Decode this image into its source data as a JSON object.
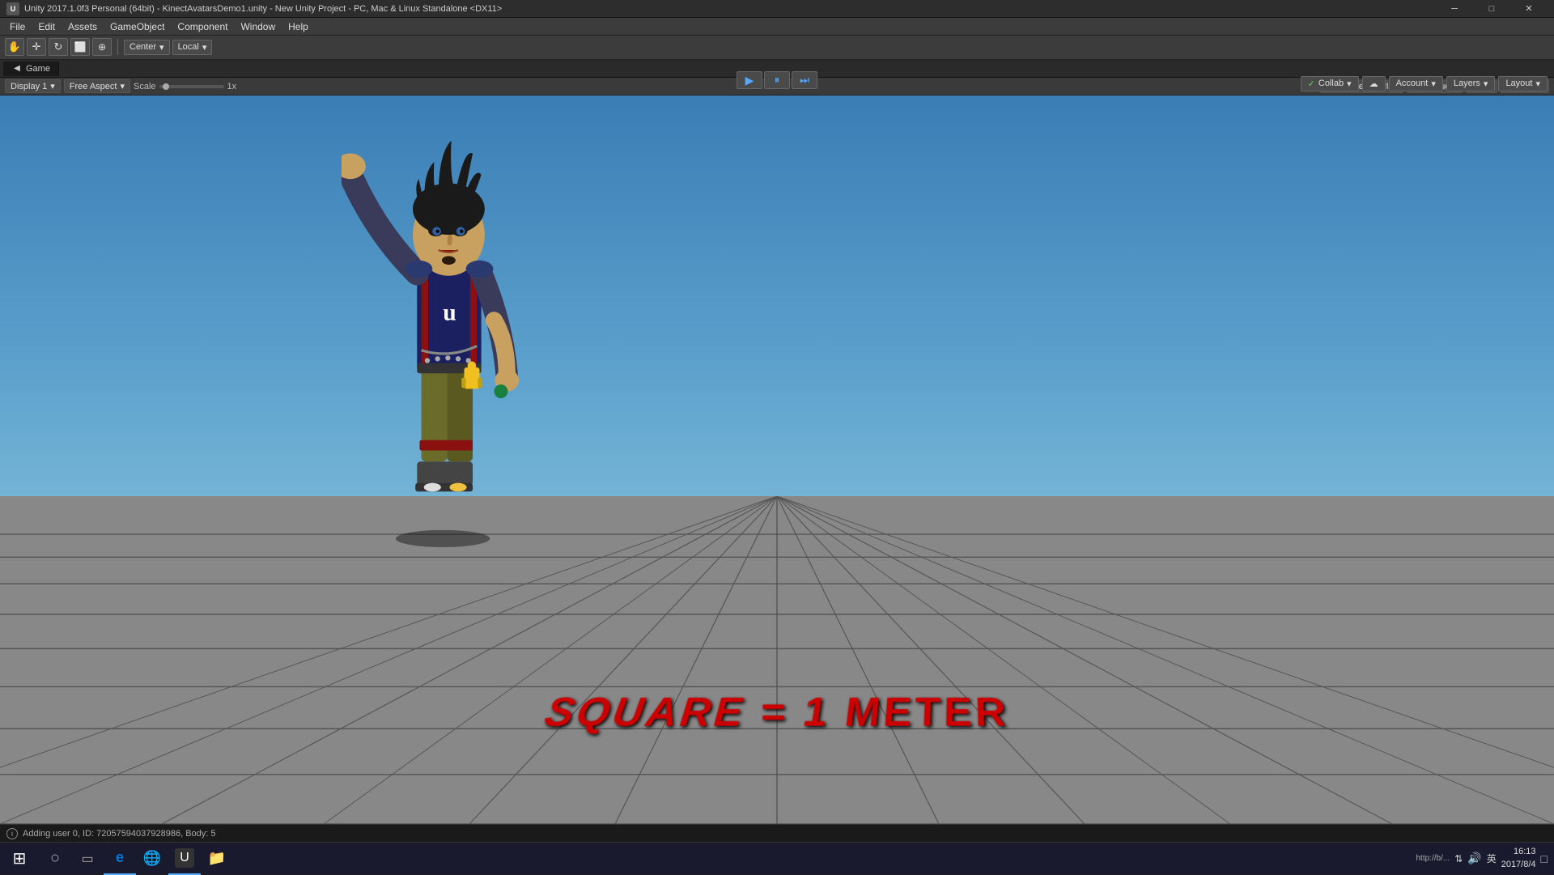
{
  "titlebar": {
    "icon_label": "U",
    "title": "Unity 2017.1.0f3 Personal (64bit) - KinectAvatarsDemo1.unity - New Unity Project - PC, Mac & Linux Standalone <DX11>",
    "min_btn": "─",
    "max_btn": "□",
    "close_btn": "✕"
  },
  "menubar": {
    "items": [
      "File",
      "Edit",
      "Assets",
      "GameObject",
      "Component",
      "Window",
      "Help"
    ]
  },
  "toolbar": {
    "tools": [
      "↺",
      "✛",
      "⟳",
      "⬜",
      "⊕"
    ],
    "transform_center": "Center",
    "transform_local": "Local"
  },
  "play_controls": {
    "play_btn": "▶",
    "pause_btn": "⏸",
    "step_btn": "⏭"
  },
  "right_toolbar": {
    "collab_label": "Collab",
    "cloud_icon": "☁",
    "account_label": "Account",
    "layers_label": "Layers",
    "layout_label": "Layout"
  },
  "game_panel": {
    "tab_icon": "◀",
    "tab_label": "Game"
  },
  "game_view_toolbar": {
    "display_label": "Display 1",
    "aspect_label": "Free Aspect",
    "scale_label": "Scale",
    "scale_value": "1x",
    "right_buttons": [
      "Maximize On Play",
      "Mute Audio",
      "Stats",
      "Gizmos"
    ]
  },
  "scene": {
    "floor_text": "SQUARE = 1 METER"
  },
  "status_bar": {
    "message": "Adding user 0, ID: 72057594037928986, Body: 5"
  },
  "taskbar": {
    "start_icon": "⊞",
    "search_icon": "○",
    "task_icon": "▭",
    "browser_e_icon": "e",
    "browser_chrome_icon": "●",
    "unity_icon": "U",
    "folder_icon": "📁",
    "systray": {
      "url_text": "http://b/...",
      "network_icon": "⌂",
      "volume_icon": "🔊",
      "lang_text": "英",
      "time": "16:13",
      "date": "2017/8/4",
      "notification_icon": "□"
    }
  }
}
